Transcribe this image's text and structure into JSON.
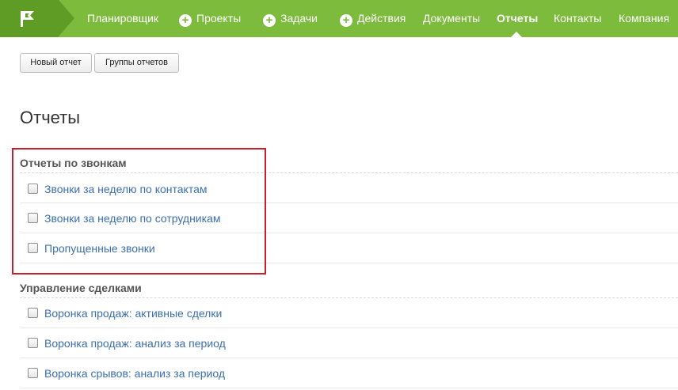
{
  "nav": {
    "items": [
      {
        "label": "Планировщик",
        "has_plus": false,
        "active": false
      },
      {
        "label": "Проекты",
        "has_plus": true,
        "active": false
      },
      {
        "label": "Задачи",
        "has_plus": true,
        "active": false
      },
      {
        "label": "Действия",
        "has_plus": true,
        "active": false
      },
      {
        "label": "Документы",
        "has_plus": false,
        "active": false
      },
      {
        "label": "Отчеты",
        "has_plus": false,
        "active": true
      },
      {
        "label": "Контакты",
        "has_plus": false,
        "active": false
      },
      {
        "label": "Компания",
        "has_plus": false,
        "active": false
      }
    ],
    "plus_glyph": "+",
    "brand_color": "#7dbb3c"
  },
  "toolbar": {
    "new_report_label": "Новый отчет",
    "report_groups_label": "Группы отчетов"
  },
  "page": {
    "title": "Отчеты"
  },
  "groups": [
    {
      "title": "Отчеты по звонкам",
      "reports": [
        "Звонки за неделю по контактам",
        "Звонки за неделю по сотрудникам",
        "Пропущенные звонки"
      ]
    },
    {
      "title": "Управление сделками",
      "reports": [
        "Воронка продаж: активные сделки",
        "Воронка продаж: анализ за период",
        "Воронка срывов: анализ за период"
      ]
    }
  ],
  "highlight_color": "#c8202a"
}
